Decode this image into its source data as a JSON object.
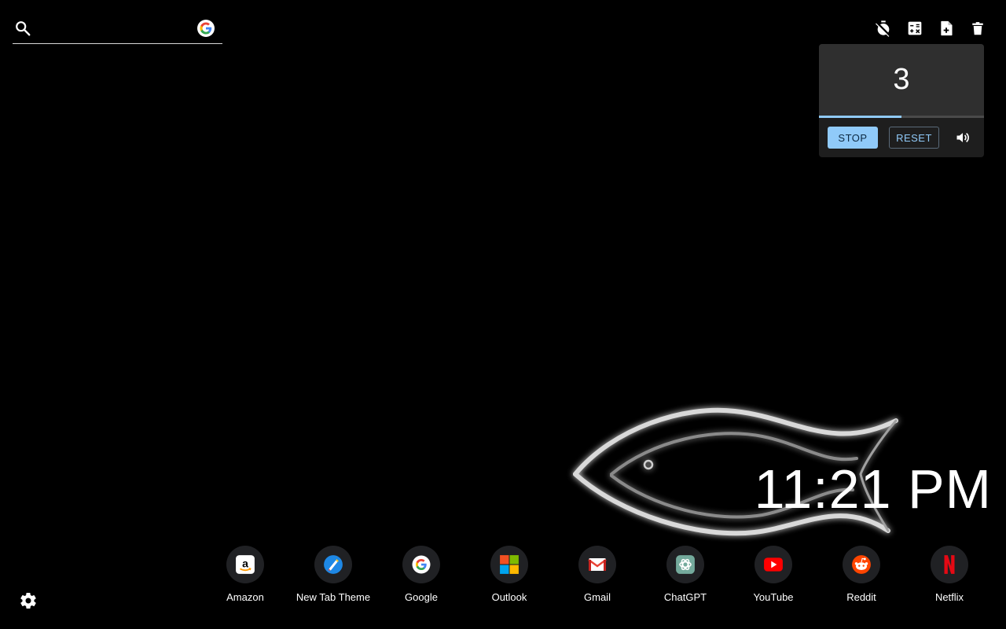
{
  "search": {
    "value": "",
    "placeholder": "",
    "engine_icon": "google-icon"
  },
  "toolbar": {
    "icons": [
      "timer-off-icon",
      "calculator-icon",
      "note-add-icon",
      "delete-icon"
    ]
  },
  "timer": {
    "value": "3",
    "progress": 0.5,
    "stop_label": "STOP",
    "reset_label": "RESET",
    "volume_icon": "volume-icon"
  },
  "clock": {
    "time": "11:21 PM"
  },
  "shortcuts": [
    {
      "label": "Amazon",
      "icon": "amazon-icon"
    },
    {
      "label": "New Tab Theme",
      "icon": "new-tab-theme-icon"
    },
    {
      "label": "Google",
      "icon": "google-icon"
    },
    {
      "label": "Outlook",
      "icon": "microsoft-icon"
    },
    {
      "label": "Gmail",
      "icon": "gmail-icon"
    },
    {
      "label": "ChatGPT",
      "icon": "chatgpt-icon"
    },
    {
      "label": "YouTube",
      "icon": "youtube-icon"
    },
    {
      "label": "Reddit",
      "icon": "reddit-icon"
    },
    {
      "label": "Netflix",
      "icon": "netflix-icon"
    }
  ],
  "settings": {
    "icon": "gear-icon"
  },
  "colors": {
    "background": "#000000",
    "accent": "#90caf9",
    "timer_display": "#2f2f2f",
    "timer_card": "#1e1e1e",
    "shortcut_circle": "#202124"
  }
}
